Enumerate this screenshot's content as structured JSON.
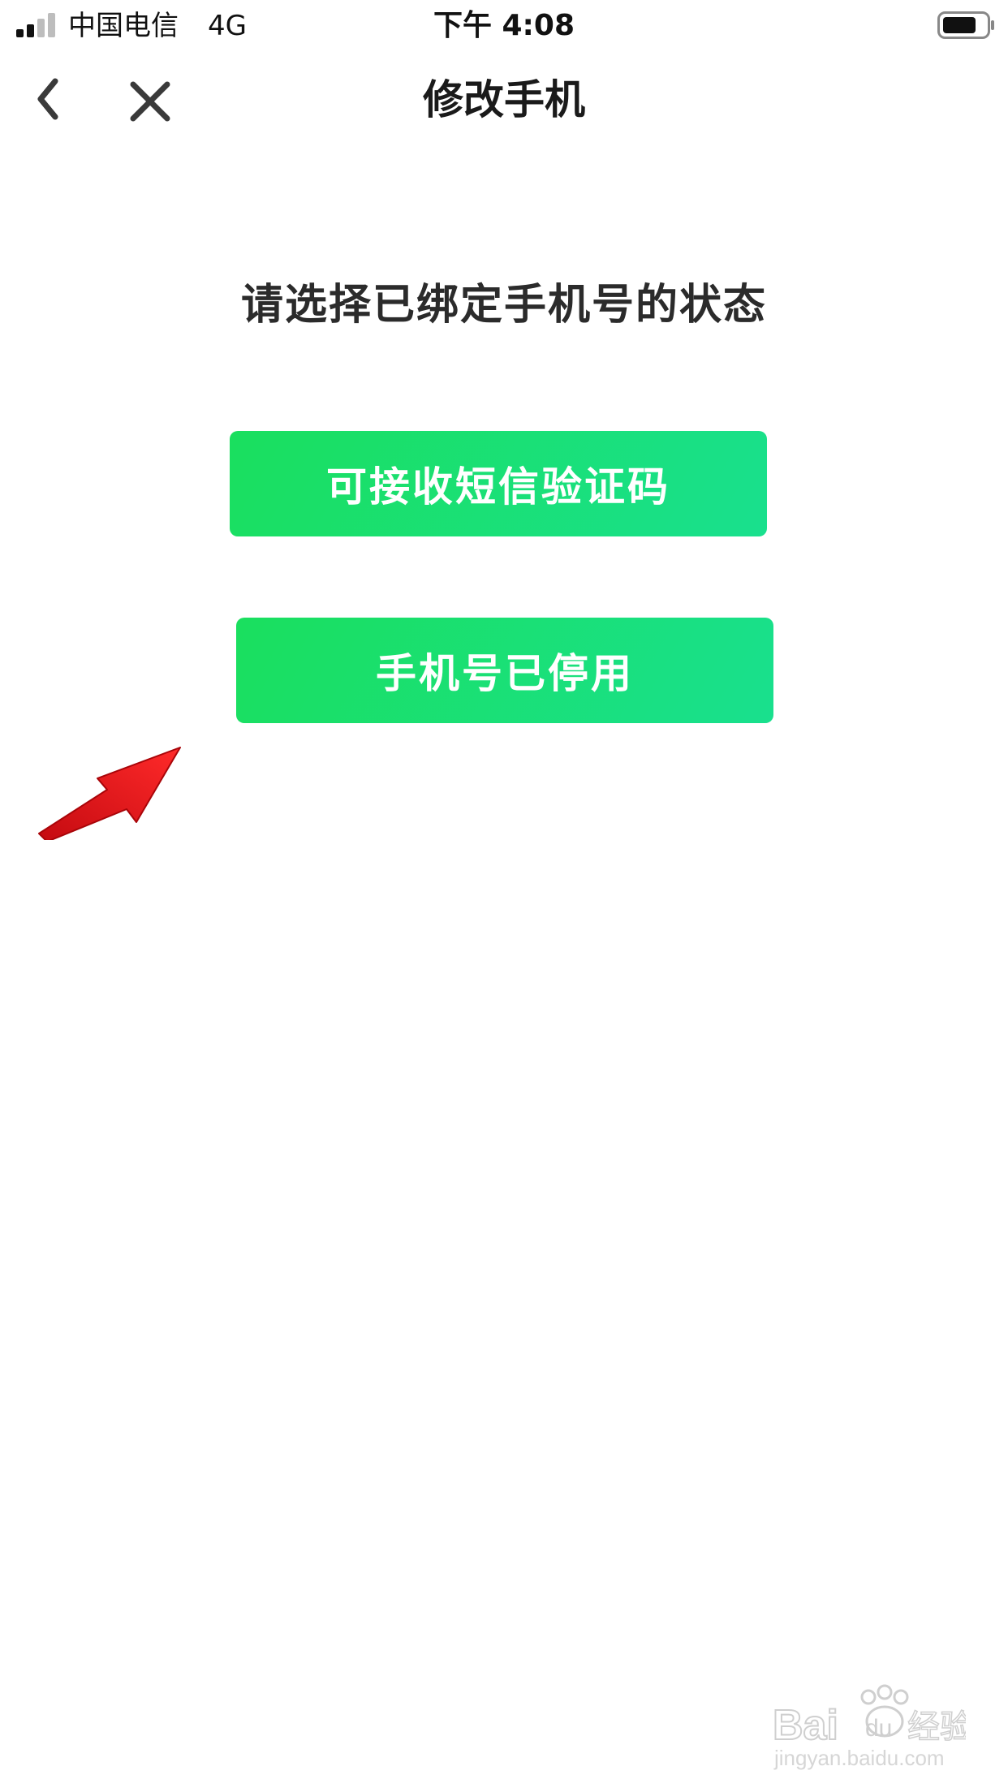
{
  "status_bar": {
    "carrier": "中国电信",
    "network": "4G",
    "time": "下午 4:08",
    "signal_icon": "signal-bars-icon",
    "battery_icon": "battery-icon"
  },
  "nav": {
    "title": "修改手机",
    "back_icon": "chevron-left-icon",
    "close_icon": "close-icon"
  },
  "content": {
    "prompt": "请选择已绑定手机号的状态",
    "options": [
      {
        "label": "可接收短信验证码"
      },
      {
        "label": "手机号已停用"
      }
    ]
  },
  "colors": {
    "button_gradient_start": "#1adf5e",
    "button_gradient_end": "#19e08e",
    "annotation_arrow": "#e8141a"
  },
  "watermark": {
    "brand": "Bai du 经验",
    "url": "jingyan.baidu.com"
  }
}
